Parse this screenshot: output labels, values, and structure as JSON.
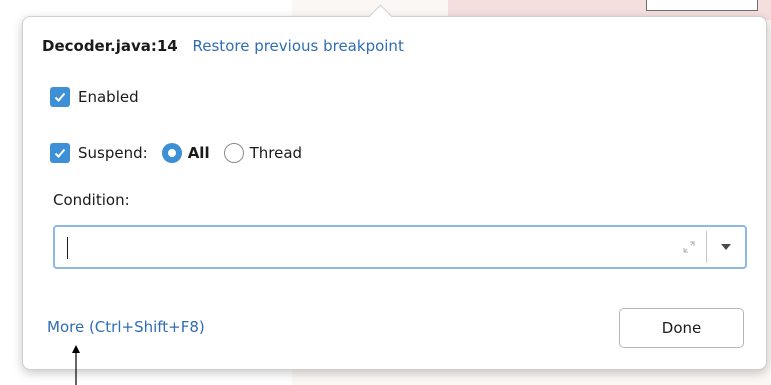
{
  "breakpoint": {
    "location": "Decoder.java:14",
    "restore_link": "Restore previous breakpoint"
  },
  "enabled": {
    "label": "Enabled",
    "checked": true
  },
  "suspend": {
    "label": "Suspend:",
    "checked": true,
    "options": [
      {
        "label": "All",
        "selected": true
      },
      {
        "label": "Thread",
        "selected": false
      }
    ]
  },
  "condition": {
    "label": "Condition:",
    "value": ""
  },
  "footer": {
    "more_link": "More (Ctrl+Shift+F8)",
    "done_label": "Done"
  },
  "colors": {
    "accent": "#3d8fd6",
    "link": "#2f6db5",
    "field_border": "#8cb8e8"
  },
  "icons": [
    "check-icon",
    "radio-selected-icon",
    "radio-unselected-icon",
    "expand-icon",
    "dropdown-arrow-icon",
    "annotation-arrow-icon"
  ]
}
